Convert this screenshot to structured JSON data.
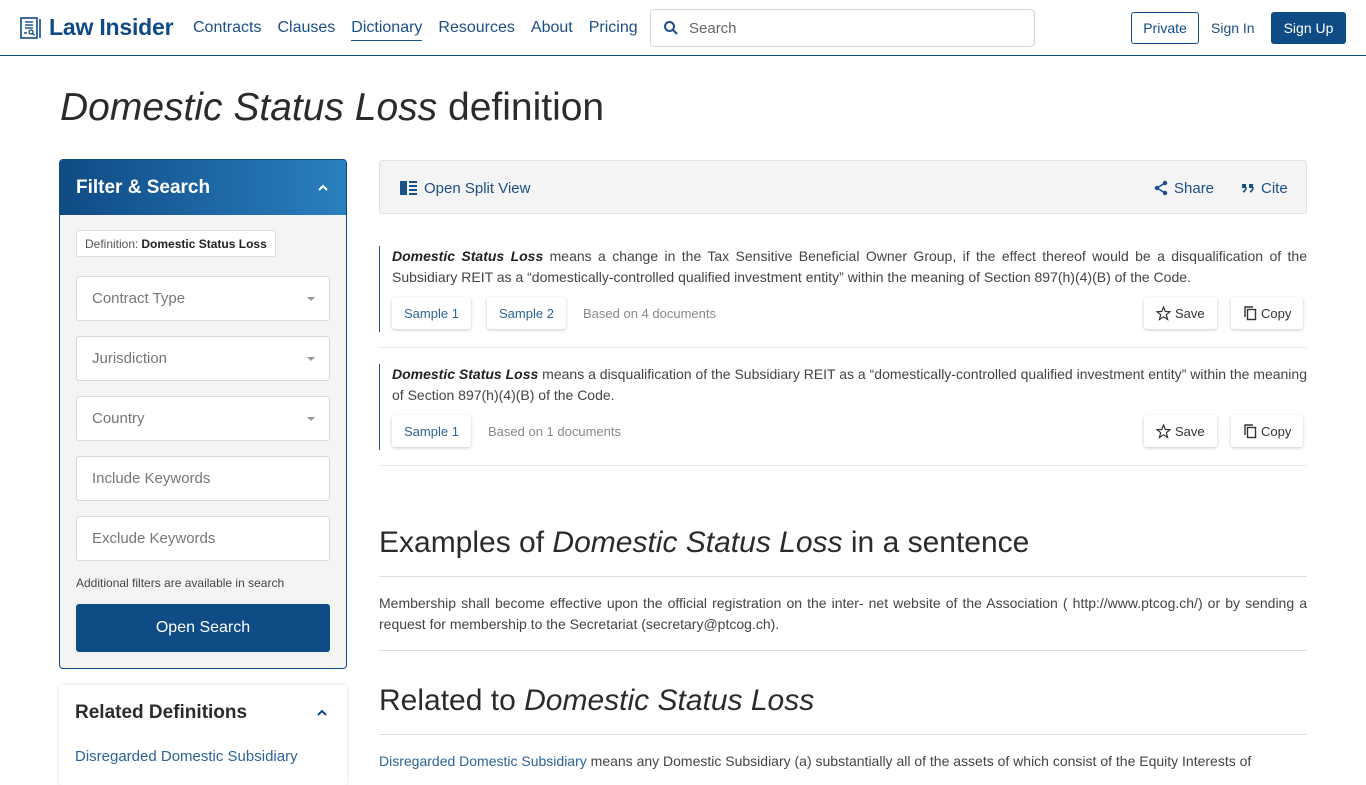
{
  "header": {
    "logo_text": "Law Insider",
    "nav": [
      {
        "label": "Contracts",
        "active": false
      },
      {
        "label": "Clauses",
        "active": false
      },
      {
        "label": "Dictionary",
        "active": true
      },
      {
        "label": "Resources",
        "active": false
      },
      {
        "label": "About",
        "active": false
      },
      {
        "label": "Pricing",
        "active": false
      }
    ],
    "search_placeholder": "Search",
    "private_label": "Private",
    "signin_label": "Sign In",
    "signup_label": "Sign Up",
    "brand_color": "#0f4b85"
  },
  "page": {
    "title_term": "Domestic Status Loss",
    "title_suffix": "definition"
  },
  "filter": {
    "title": "Filter & Search",
    "chip_label": "Definition:",
    "chip_value": "Domestic Status Loss",
    "contract_type_placeholder": "Contract Type",
    "jurisdiction_placeholder": "Jurisdiction",
    "country_placeholder": "Country",
    "include_placeholder": "Include Keywords",
    "exclude_placeholder": "Exclude Keywords",
    "note": "Additional filters are available in search",
    "open_search_label": "Open Search"
  },
  "related_panel": {
    "title": "Related Definitions",
    "items": [
      "Disregarded Domestic Subsidiary"
    ]
  },
  "toolbar": {
    "split_view_label": "Open Split View",
    "share_label": "Share",
    "cite_label": "Cite"
  },
  "definitions": [
    {
      "term": "Domestic Status Loss",
      "text": " means a change in the Tax Sensitive Beneficial Owner Group, if the effect thereof would be a disqualification of the Subsidiary REIT as a “domestically-controlled qualified investment entity” within the meaning of Section 897(h)(4)(B) of the Code.",
      "samples": [
        "Sample 1",
        "Sample 2"
      ],
      "based_on": "Based on 4 documents",
      "save_label": "Save",
      "copy_label": "Copy"
    },
    {
      "term": "Domestic Status Loss",
      "text": " means a disqualification of the Subsidiary REIT as a “domestically-controlled qualified investment entity” within the meaning of Section 897(h)(4)(B) of the Code.",
      "samples": [
        "Sample 1"
      ],
      "based_on": "Based on 1 documents",
      "save_label": "Save",
      "copy_label": "Copy"
    }
  ],
  "examples": {
    "title_prefix": "Examples of",
    "title_term": "Domestic Status Loss",
    "title_suffix": "in a sentence",
    "sentence": "Membership shall become effective upon the official registration on the inter- net website of the Association ( http://www.ptcog.ch/) or by sending a request for membership to the Secretariat (secretary@ptcog.ch)."
  },
  "related": {
    "title_prefix": "Related to",
    "title_term": "Domestic Status Loss",
    "items": [
      {
        "term": "Disregarded Domestic Subsidiary",
        "text": " means any Domestic Subsidiary (a) substantially all of the assets of which consist of the Equity Interests of"
      }
    ]
  }
}
